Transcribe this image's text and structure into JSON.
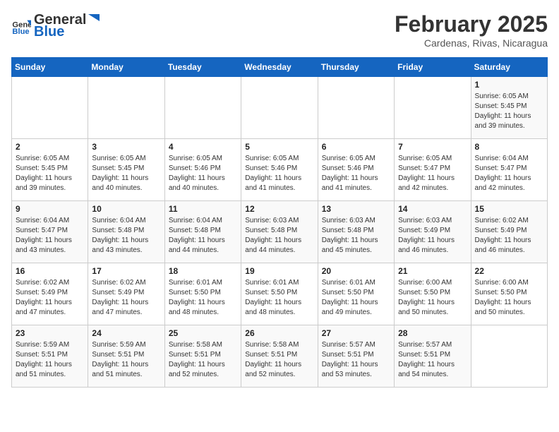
{
  "header": {
    "logo_general": "General",
    "logo_blue": "Blue",
    "month_year": "February 2025",
    "location": "Cardenas, Rivas, Nicaragua"
  },
  "weekdays": [
    "Sunday",
    "Monday",
    "Tuesday",
    "Wednesday",
    "Thursday",
    "Friday",
    "Saturday"
  ],
  "weeks": [
    [
      {
        "day": "",
        "info": ""
      },
      {
        "day": "",
        "info": ""
      },
      {
        "day": "",
        "info": ""
      },
      {
        "day": "",
        "info": ""
      },
      {
        "day": "",
        "info": ""
      },
      {
        "day": "",
        "info": ""
      },
      {
        "day": "1",
        "info": "Sunrise: 6:05 AM\nSunset: 5:45 PM\nDaylight: 11 hours\nand 39 minutes."
      }
    ],
    [
      {
        "day": "2",
        "info": "Sunrise: 6:05 AM\nSunset: 5:45 PM\nDaylight: 11 hours\nand 39 minutes."
      },
      {
        "day": "3",
        "info": "Sunrise: 6:05 AM\nSunset: 5:45 PM\nDaylight: 11 hours\nand 40 minutes."
      },
      {
        "day": "4",
        "info": "Sunrise: 6:05 AM\nSunset: 5:46 PM\nDaylight: 11 hours\nand 40 minutes."
      },
      {
        "day": "5",
        "info": "Sunrise: 6:05 AM\nSunset: 5:46 PM\nDaylight: 11 hours\nand 41 minutes."
      },
      {
        "day": "6",
        "info": "Sunrise: 6:05 AM\nSunset: 5:46 PM\nDaylight: 11 hours\nand 41 minutes."
      },
      {
        "day": "7",
        "info": "Sunrise: 6:05 AM\nSunset: 5:47 PM\nDaylight: 11 hours\nand 42 minutes."
      },
      {
        "day": "8",
        "info": "Sunrise: 6:04 AM\nSunset: 5:47 PM\nDaylight: 11 hours\nand 42 minutes."
      }
    ],
    [
      {
        "day": "9",
        "info": "Sunrise: 6:04 AM\nSunset: 5:47 PM\nDaylight: 11 hours\nand 43 minutes."
      },
      {
        "day": "10",
        "info": "Sunrise: 6:04 AM\nSunset: 5:48 PM\nDaylight: 11 hours\nand 43 minutes."
      },
      {
        "day": "11",
        "info": "Sunrise: 6:04 AM\nSunset: 5:48 PM\nDaylight: 11 hours\nand 44 minutes."
      },
      {
        "day": "12",
        "info": "Sunrise: 6:03 AM\nSunset: 5:48 PM\nDaylight: 11 hours\nand 44 minutes."
      },
      {
        "day": "13",
        "info": "Sunrise: 6:03 AM\nSunset: 5:48 PM\nDaylight: 11 hours\nand 45 minutes."
      },
      {
        "day": "14",
        "info": "Sunrise: 6:03 AM\nSunset: 5:49 PM\nDaylight: 11 hours\nand 46 minutes."
      },
      {
        "day": "15",
        "info": "Sunrise: 6:02 AM\nSunset: 5:49 PM\nDaylight: 11 hours\nand 46 minutes."
      }
    ],
    [
      {
        "day": "16",
        "info": "Sunrise: 6:02 AM\nSunset: 5:49 PM\nDaylight: 11 hours\nand 47 minutes."
      },
      {
        "day": "17",
        "info": "Sunrise: 6:02 AM\nSunset: 5:49 PM\nDaylight: 11 hours\nand 47 minutes."
      },
      {
        "day": "18",
        "info": "Sunrise: 6:01 AM\nSunset: 5:50 PM\nDaylight: 11 hours\nand 48 minutes."
      },
      {
        "day": "19",
        "info": "Sunrise: 6:01 AM\nSunset: 5:50 PM\nDaylight: 11 hours\nand 48 minutes."
      },
      {
        "day": "20",
        "info": "Sunrise: 6:01 AM\nSunset: 5:50 PM\nDaylight: 11 hours\nand 49 minutes."
      },
      {
        "day": "21",
        "info": "Sunrise: 6:00 AM\nSunset: 5:50 PM\nDaylight: 11 hours\nand 50 minutes."
      },
      {
        "day": "22",
        "info": "Sunrise: 6:00 AM\nSunset: 5:50 PM\nDaylight: 11 hours\nand 50 minutes."
      }
    ],
    [
      {
        "day": "23",
        "info": "Sunrise: 5:59 AM\nSunset: 5:51 PM\nDaylight: 11 hours\nand 51 minutes."
      },
      {
        "day": "24",
        "info": "Sunrise: 5:59 AM\nSunset: 5:51 PM\nDaylight: 11 hours\nand 51 minutes."
      },
      {
        "day": "25",
        "info": "Sunrise: 5:58 AM\nSunset: 5:51 PM\nDaylight: 11 hours\nand 52 minutes."
      },
      {
        "day": "26",
        "info": "Sunrise: 5:58 AM\nSunset: 5:51 PM\nDaylight: 11 hours\nand 52 minutes."
      },
      {
        "day": "27",
        "info": "Sunrise: 5:57 AM\nSunset: 5:51 PM\nDaylight: 11 hours\nand 53 minutes."
      },
      {
        "day": "28",
        "info": "Sunrise: 5:57 AM\nSunset: 5:51 PM\nDaylight: 11 hours\nand 54 minutes."
      },
      {
        "day": "",
        "info": ""
      }
    ]
  ]
}
